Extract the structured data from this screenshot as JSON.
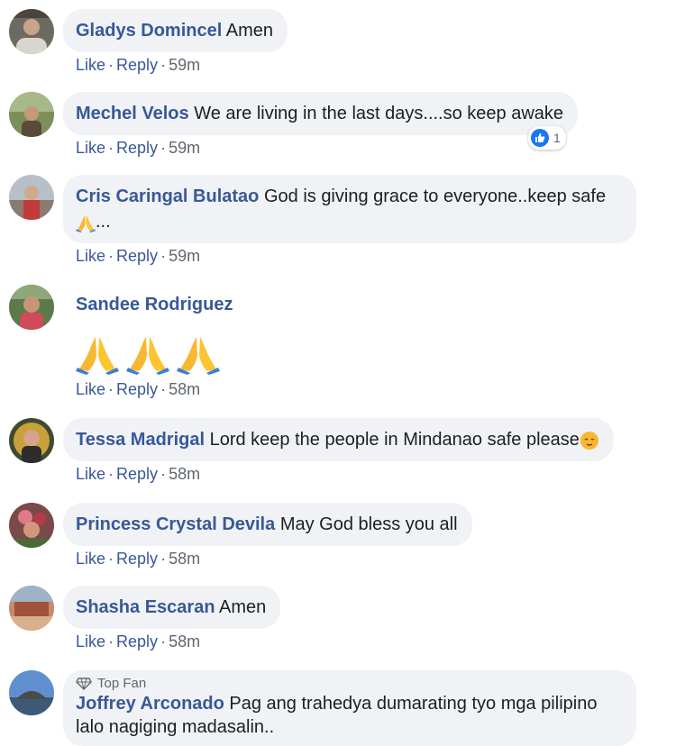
{
  "actions": {
    "like": "Like",
    "reply": "Reply",
    "sep": "·"
  },
  "comments": [
    {
      "author": "Gladys Domincel",
      "text": "Amen",
      "time": "59m"
    },
    {
      "author": "Mechel Velos",
      "text": "We are living in the last days....so keep awake",
      "time": "59m",
      "reaction_count": "1",
      "reaction_icon": "thumbs-up-icon"
    },
    {
      "author": "Cris Caringal Bulatao",
      "text": "God is giving grace to everyone..keep safe",
      "text2": "...",
      "time": "59m"
    },
    {
      "author": "Sandee Rodriguez",
      "text": "",
      "time": "58m"
    },
    {
      "author": "Tessa Madrigal",
      "text": "Lord keep the people in Mindanao safe please",
      "time": "58m"
    },
    {
      "author": "Princess Crystal Devila",
      "text": "May God bless you all",
      "time": "58m"
    },
    {
      "author": "Shasha Escaran",
      "text": "Amen",
      "time": "58m"
    },
    {
      "author": "Joffrey Arconado",
      "badge": "Top Fan",
      "text": "Pag ang trahedya dumarating tyo mga pilipino",
      "text2": "lalo nagiging madasalin.."
    }
  ],
  "colors": {
    "author": "#385898",
    "bubble": "#f0f2f5",
    "meta": "#606770",
    "like_blue": "#1877f2"
  }
}
